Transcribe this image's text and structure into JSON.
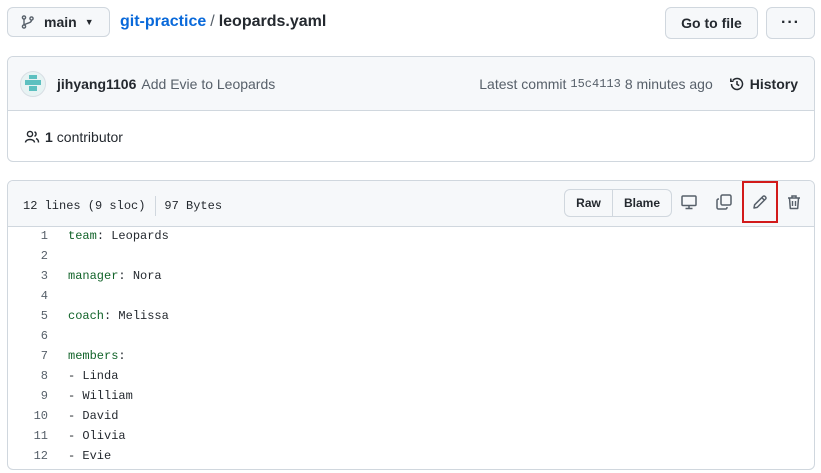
{
  "header": {
    "branch": "main",
    "repo": "git-practice",
    "separator": "/",
    "filename": "leopards.yaml",
    "goto_label": "Go to file",
    "more_label": "···"
  },
  "commit": {
    "author": "jihyang1106",
    "message": "Add Evie to Leopards",
    "latest_label": "Latest commit",
    "sha": "15c4113",
    "time": "8 minutes ago",
    "history_label": "History"
  },
  "contributors": {
    "count": "1",
    "label": "contributor"
  },
  "file": {
    "lines_info": "12 lines (9 sloc)",
    "size": "97 Bytes",
    "raw_label": "Raw",
    "blame_label": "Blame",
    "icons": [
      "display-icon",
      "copy-icon",
      "pencil-icon",
      "trash-icon"
    ],
    "highlight_color": "#d21a1a"
  },
  "code": [
    {
      "n": "1",
      "key": "team",
      "rest": " Leopards"
    },
    {
      "n": "2",
      "text": ""
    },
    {
      "n": "3",
      "key": "manager",
      "rest": " Nora"
    },
    {
      "n": "4",
      "text": ""
    },
    {
      "n": "5",
      "key": "coach",
      "rest": " Melissa"
    },
    {
      "n": "6",
      "text": ""
    },
    {
      "n": "7",
      "key": "members",
      "rest": ""
    },
    {
      "n": "8",
      "text": "- Linda"
    },
    {
      "n": "9",
      "text": "- William"
    },
    {
      "n": "10",
      "text": "- David"
    },
    {
      "n": "11",
      "text": "- Olivia"
    },
    {
      "n": "12",
      "text": "- Evie"
    }
  ]
}
